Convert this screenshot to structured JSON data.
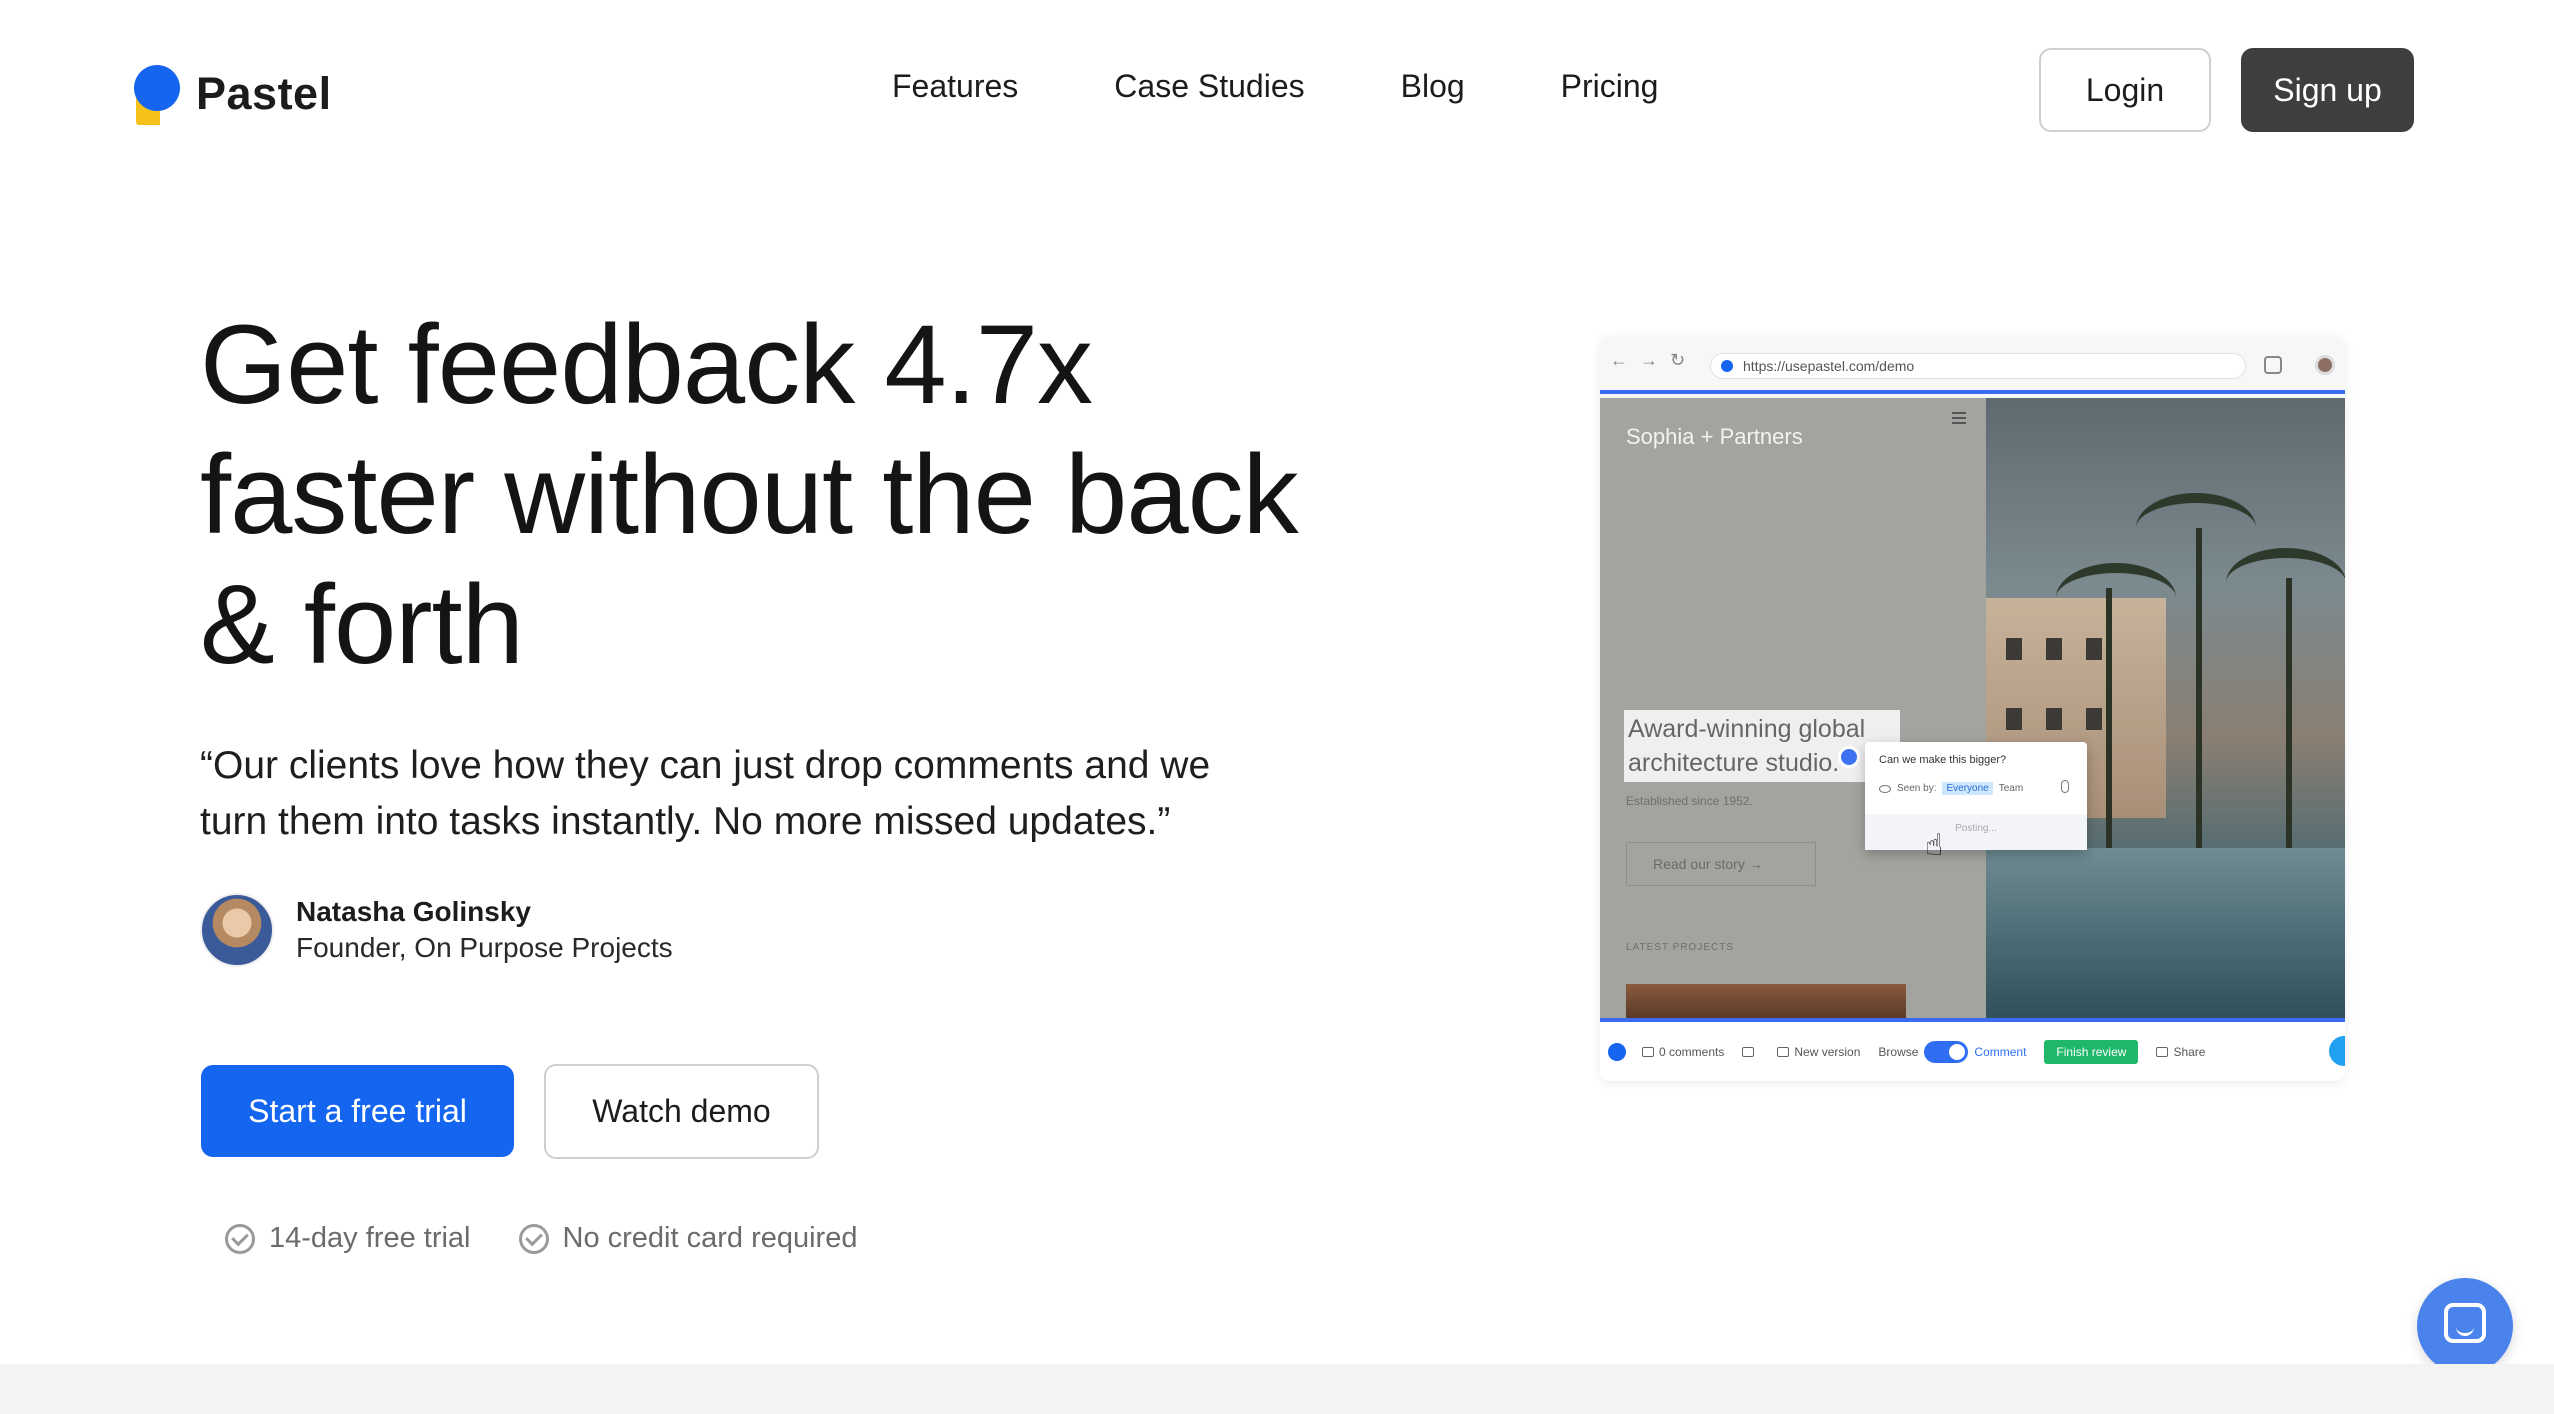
{
  "brand": {
    "name": "Pastel",
    "colors": {
      "blue": "#1565f0",
      "yellow": "#f6c21a"
    }
  },
  "nav": {
    "links": [
      "Features",
      "Case Studies",
      "Blog",
      "Pricing"
    ],
    "login": "Login",
    "signup": "Sign up"
  },
  "hero": {
    "headline_lines": [
      "Get feedback 4.7x",
      "faster without the back",
      "& forth"
    ],
    "quote_lines": [
      "“Our clients love how they can just drop comments and we",
      "turn them into tasks instantly. No more missed updates.”"
    ],
    "author": {
      "name": "Natasha Golinsky",
      "role": "Founder, On Purpose Projects"
    },
    "cta_primary": "Start a free trial",
    "cta_secondary": "Watch demo",
    "perks": [
      "14-day free trial",
      "No credit card required"
    ]
  },
  "demo": {
    "url": "https://usepastel.com/demo",
    "site_brand": "Sophia + Partners",
    "site_headline_lines": [
      "Award-winning global",
      "architecture studio."
    ],
    "site_established": "Established since 1952.",
    "site_cta": "Read our story →",
    "site_latest": "LATEST PROJECTS",
    "comment": {
      "question": "Can we make this bigger?",
      "seen_by_label": "Seen by:",
      "seen_options": [
        "Everyone",
        "Team"
      ],
      "status": "Posting..."
    },
    "toolbar": {
      "comments": "0 comments",
      "new_version": "New version",
      "browse": "Browse",
      "comment": "Comment",
      "finish": "Finish review",
      "share": "Share"
    }
  },
  "colors": {
    "primary": "#1466f0",
    "signup_bg": "#3e3e3e",
    "finish_green": "#1fb86a",
    "chat": "#4a83ec"
  }
}
